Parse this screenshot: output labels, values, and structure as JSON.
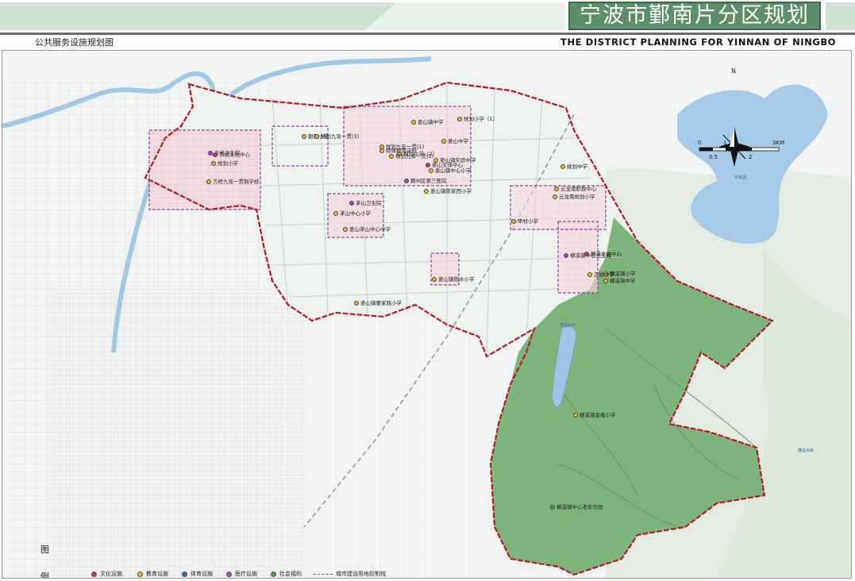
{
  "header": {
    "title": "宁波市鄞南片分区规划",
    "subtitle_cn": "公共服务设施规划图",
    "subtitle_en": "THE DISTRICT PLANNING FOR YINNAN OF NINGBO"
  },
  "compass": {
    "label": "N"
  },
  "scale": {
    "ticks": [
      "0",
      "1",
      "3KM"
    ],
    "sub_ticks": [
      "0.5",
      "2"
    ]
  },
  "legend": {
    "title_top": "图",
    "title_bottom": "例",
    "items": [
      {
        "label": "文化设施",
        "color": "#c8364a"
      },
      {
        "label": "教育设施",
        "color": "#e8b830"
      },
      {
        "label": "体育设施",
        "color": "#3a5fbf"
      },
      {
        "label": "医疗设施",
        "color": "#b045c0"
      },
      {
        "label": "社会福利",
        "color": "#48a83c"
      }
    ],
    "boundary_label": "城市建设用地控制线"
  },
  "facilities": [
    {
      "label": "方桥卫生院",
      "color": "#b045c0"
    },
    {
      "label": "方桥文化中心",
      "color": "#c8364a"
    },
    {
      "label": "规划小学",
      "color": "#e8b830"
    },
    {
      "label": "方桥九年一贯制学校",
      "color": "#e8b830"
    },
    {
      "label": "朝阳小学",
      "color": "#e8b830"
    },
    {
      "label": "规划九年一贯(3)",
      "color": "#e8b830"
    },
    {
      "label": "规划小学（2）",
      "color": "#e8b830"
    },
    {
      "label": "姜山镇中学",
      "color": "#e8b830"
    },
    {
      "label": "规划小学（1）",
      "color": "#e8b830"
    },
    {
      "label": "规划九年一贯(1)",
      "color": "#e8b830"
    },
    {
      "label": "姜山中学",
      "color": "#e8b830"
    },
    {
      "label": "特殊教育学校",
      "color": "#e8b830"
    },
    {
      "label": "规划九年一贯(2)",
      "color": "#e8b830"
    },
    {
      "label": "姜山镇实验中学",
      "color": "#e8b830"
    },
    {
      "label": "姜山镇中心小学",
      "color": "#e8b830"
    },
    {
      "label": "姜山文体中心",
      "color": "#c8364a"
    },
    {
      "label": "鄞州区第三医院",
      "color": "#b045c0"
    },
    {
      "label": "姜山镇陈家团小学",
      "color": "#e8b830"
    },
    {
      "label": "茅山卫生院",
      "color": "#b045c0"
    },
    {
      "label": "茅山中心小学",
      "color": "#e8b830"
    },
    {
      "label": "姜山茅山中心中学",
      "color": "#e8b830"
    },
    {
      "label": "规划中学",
      "color": "#e8b830"
    },
    {
      "label": "云龙南职教中心",
      "color": "#e8b830"
    },
    {
      "label": "云龙南规划小学",
      "color": "#e8b830"
    },
    {
      "label": "甲村小学",
      "color": "#e8b830"
    },
    {
      "label": "横溪镇中心卫生院",
      "color": "#b045c0"
    },
    {
      "label": "横溪文体中心",
      "color": "#c8364a"
    },
    {
      "label": "横溪镇小学",
      "color": "#e8b830"
    },
    {
      "label": "横溪镇中学",
      "color": "#e8b830"
    },
    {
      "label": "正始中学",
      "color": "#e8b830"
    },
    {
      "label": "姜山镇陆水小学",
      "color": "#e8b830"
    },
    {
      "label": "姜山镇董家跳小学",
      "color": "#e8b830"
    },
    {
      "label": "横溪镇金峨小学",
      "color": "#e8b830"
    },
    {
      "label": "横溪镇中心老年乐园",
      "color": "#48a83c"
    }
  ],
  "water_labels": [
    "东钱湖",
    "横溪水库",
    "横溪水库"
  ]
}
